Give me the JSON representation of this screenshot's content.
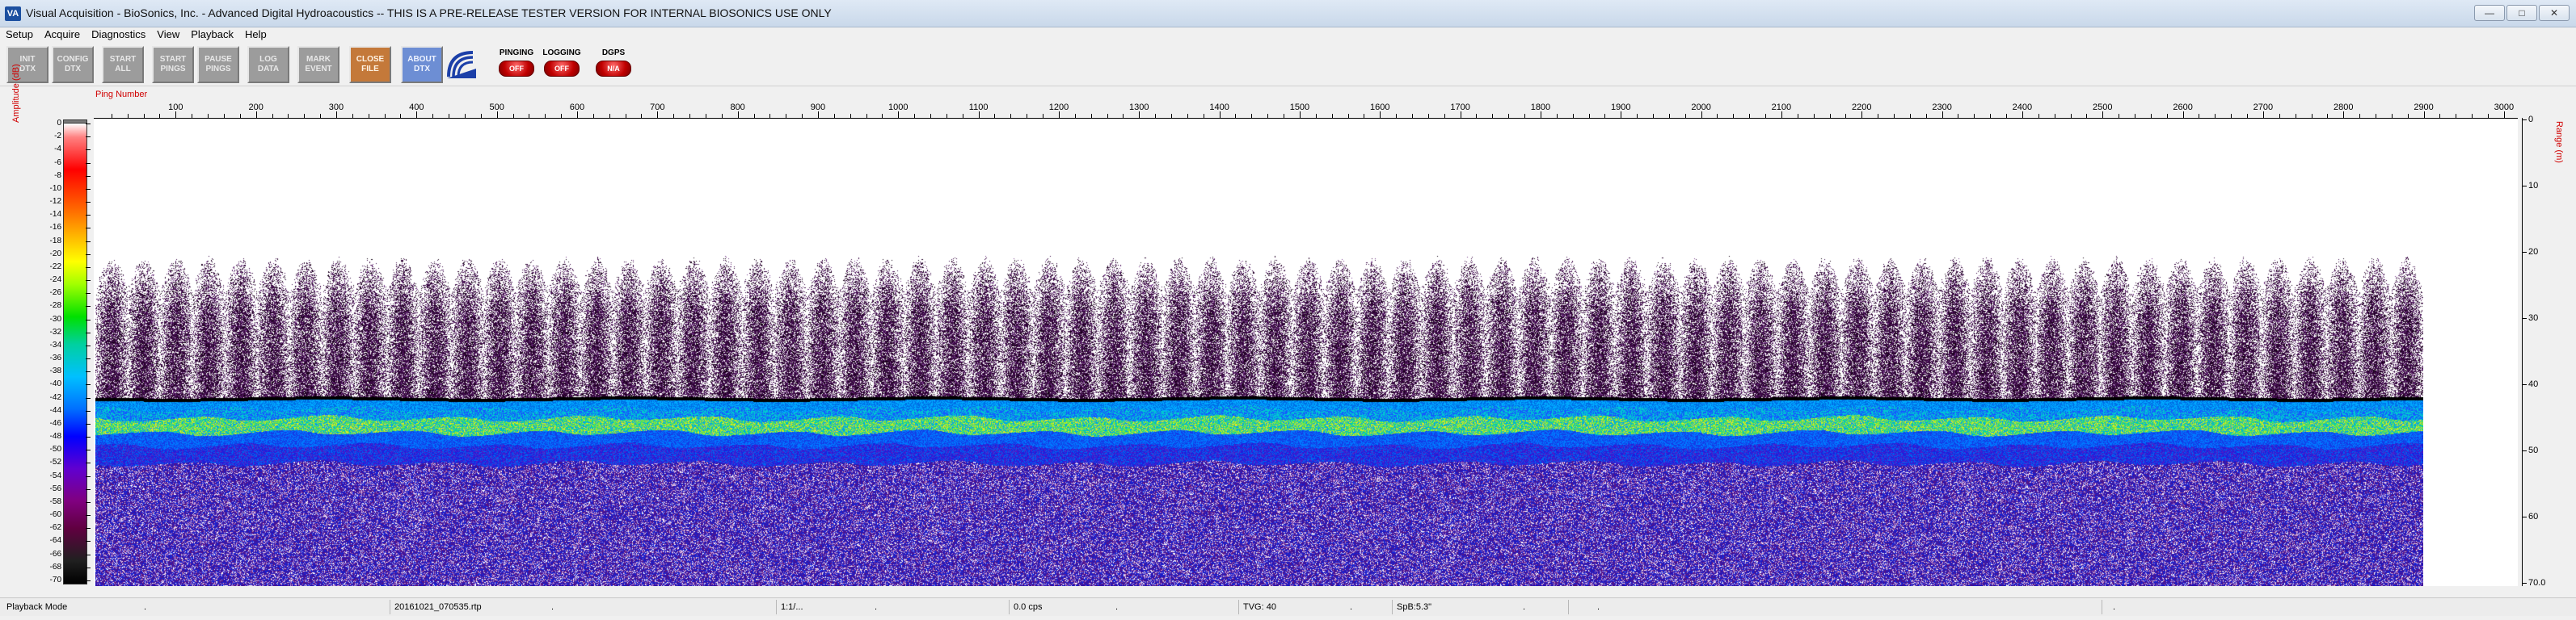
{
  "window": {
    "title": "Visual Acquisition  -  BioSonics, Inc.  -  Advanced Digital Hydroacoustics  -- THIS IS A PRE-RELEASE TESTER VERSION FOR INTERNAL BIOSONICS USE ONLY",
    "icon_text": "VA",
    "minimize": "—",
    "maximize": "□",
    "close": "✕"
  },
  "menu": [
    "Setup",
    "Acquire",
    "Diagnostics",
    "View",
    "Playback",
    "Help"
  ],
  "toolbar": {
    "buttons": [
      {
        "label": "INIT\nDTX"
      },
      {
        "label": "CONFIG\nDTX"
      },
      {
        "label": "START\nALL"
      },
      {
        "label": "START\nPINGS"
      },
      {
        "label": "PAUSE\nPINGS"
      },
      {
        "label": "LOG\nDATA"
      },
      {
        "label": "MARK\nEVENT"
      },
      {
        "label": "CLOSE\nFILE"
      },
      {
        "label": "ABOUT\nDTX"
      }
    ],
    "logo_icon": "biosonics-logo-icon",
    "status": [
      {
        "label": "PINGING",
        "value": "OFF"
      },
      {
        "label": "LOGGING",
        "value": "OFF"
      },
      {
        "label": "DGPS",
        "value": "N/A"
      }
    ]
  },
  "plot": {
    "left_axis_label": "Amplitude (dB)",
    "right_axis_label": "Range (m)",
    "top_axis_label": "Ping Number",
    "x_ticks": [
      "100",
      "200",
      "300",
      "400",
      "500",
      "600",
      "700",
      "800",
      "900",
      "1000",
      "1100",
      "1200",
      "1300",
      "1400",
      "1500",
      "1600",
      "1700",
      "1800",
      "1900",
      "2000",
      "2100",
      "2200",
      "2300",
      "2400",
      "2500",
      "2600",
      "2700",
      "2800",
      "2900",
      "3000"
    ],
    "x_range": [
      0,
      3000
    ],
    "pings_displayed": 2880,
    "y_ticks": [
      "0",
      "10",
      "20",
      "30",
      "40",
      "50",
      "60",
      "70.0"
    ],
    "y_range_m": [
      0,
      70
    ],
    "colorbar_ticks": [
      "0",
      "-2",
      "-4",
      "-6",
      "-8",
      "-10",
      "-12",
      "-14",
      "-16",
      "-18",
      "-20",
      "-22",
      "-24",
      "-26",
      "-28",
      "-30",
      "-32",
      "-34",
      "-36",
      "-38",
      "-40",
      "-42",
      "-44",
      "-46",
      "-48",
      "-50",
      "-52",
      "-54",
      "-56",
      "-58",
      "-60",
      "-62",
      "-64",
      "-66",
      "-68",
      "-70"
    ],
    "colorbar_range_db": [
      0,
      -70
    ],
    "bottom_depth_m": 42
  },
  "statusbar": {
    "mode": "Playback Mode",
    "cell1_tail": ".",
    "file": "20161021_070535.rtp",
    "cell2_tail": ".",
    "ratio": "1:1/...",
    "cell3_tail": ".",
    "rate": "0.0 cps",
    "cell4_tail": ".",
    "tvg": "TVG: 40",
    "cell5_tail": ".",
    "spb": "SpB:5.3\"",
    "cell6_tail": ".",
    "cell7_tail": ".",
    "cell8_tail": "."
  }
}
